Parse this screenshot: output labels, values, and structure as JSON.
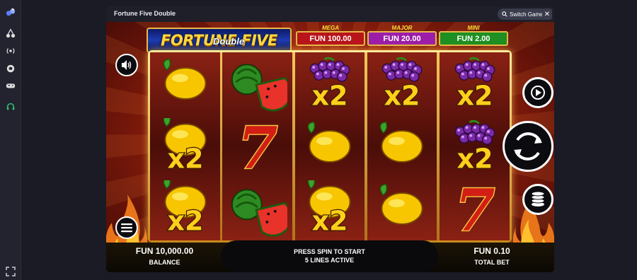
{
  "window": {
    "title": "Fortune Five Double",
    "switch_label": "Switch Game",
    "close_glyph": "✕"
  },
  "sidebar": {
    "icons": [
      "logo-icon",
      "cherries-icon",
      "live-icon",
      "soccer-ball-icon",
      "gamepad-icon",
      "headset-icon"
    ],
    "expand_icon": "expand-icon",
    "collapse_glyph": "›"
  },
  "game": {
    "logo_main": "FORTUNE FIVE",
    "logo_sub": "Double",
    "jackpots": [
      {
        "label": "MEGA",
        "value": "FUN 100.00",
        "color": "#b8141a"
      },
      {
        "label": "MAJOR",
        "value": "FUN 20.00",
        "color": "#9c1ea8"
      },
      {
        "label": "MINI",
        "value": "FUN 2.00",
        "color": "#1e8f22"
      }
    ],
    "reels": [
      [
        "lemon",
        "lemon-x2",
        "lemon-x2"
      ],
      [
        "watermelon",
        "seven",
        "watermelon"
      ],
      [
        "grapes-x2",
        "lemon",
        "lemon-x2"
      ],
      [
        "grapes-x2",
        "lemon",
        "lemon"
      ],
      [
        "grapes-x2",
        "grapes-x2",
        "seven"
      ]
    ],
    "multiplier_text": "x2",
    "seven_text": "7",
    "balance_amount": "FUN 10,000.00",
    "balance_label": "BALANCE",
    "message_line1": "PRESS SPIN TO START",
    "message_line2": "5 LINES ACTIVE",
    "bet_amount": "FUN 0.10",
    "bet_label": "TOTAL BET",
    "buttons": [
      "sound-icon",
      "menu-icon",
      "autoplay-icon",
      "spin-icon",
      "coins-bet-icon"
    ]
  }
}
